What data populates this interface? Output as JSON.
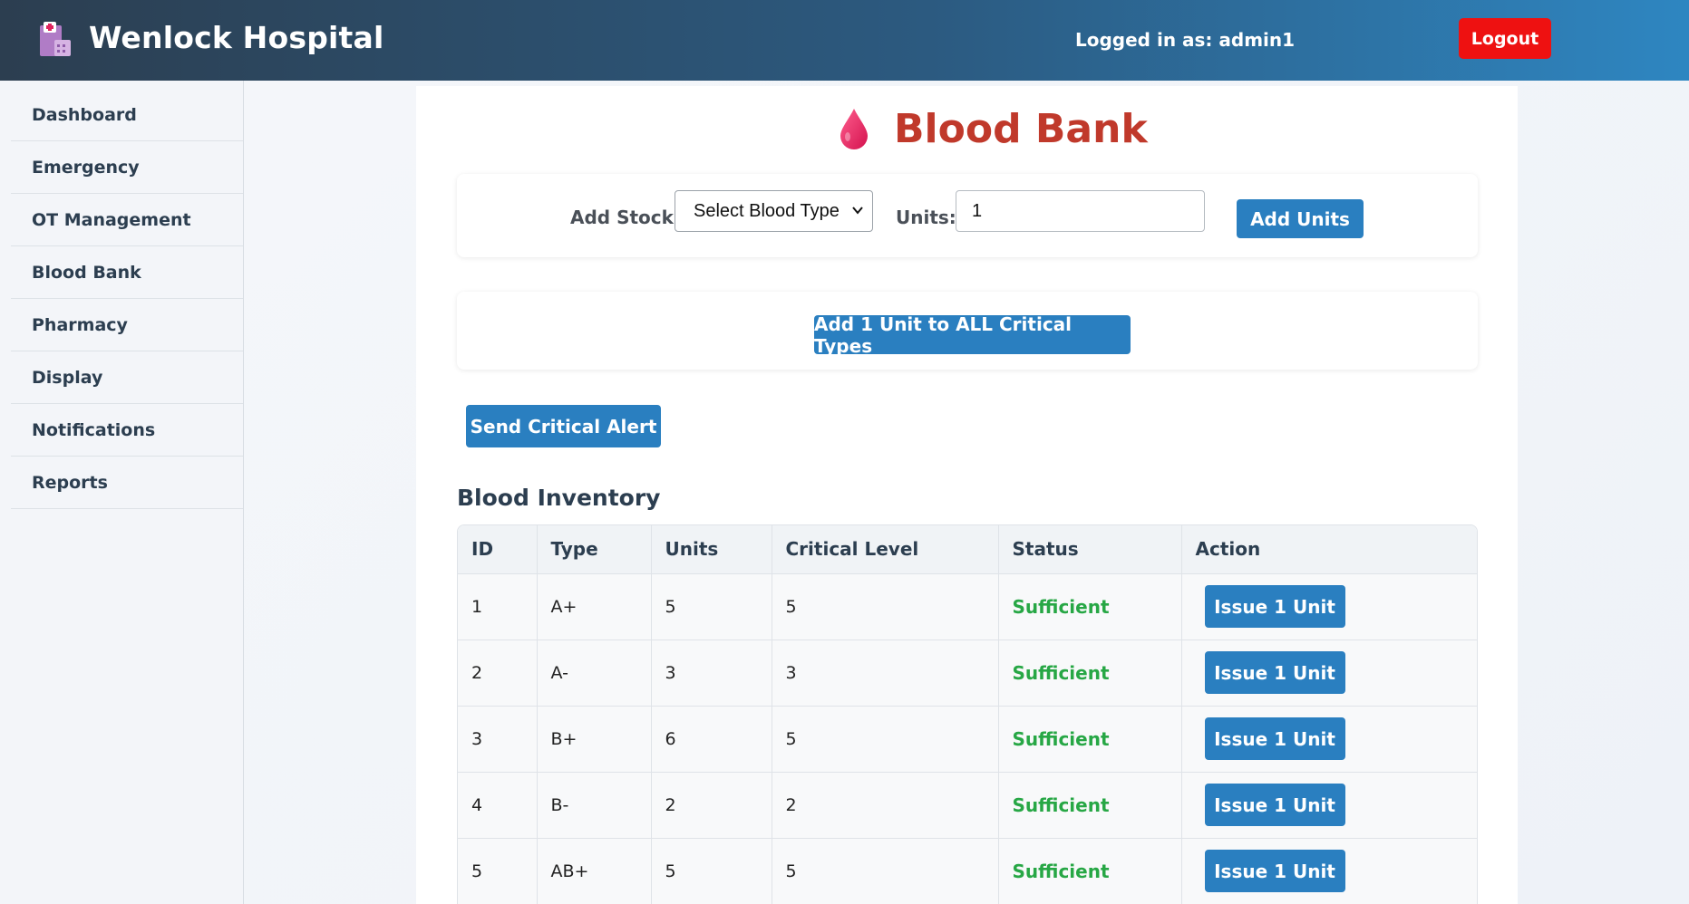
{
  "header": {
    "app_title": "Wenlock Hospital",
    "logged_in_text": "Logged in as: admin1",
    "logout_label": "Logout",
    "logo_icon": "hospital-building-icon"
  },
  "sidebar": {
    "items": [
      {
        "label": "Dashboard"
      },
      {
        "label": "Emergency"
      },
      {
        "label": "OT Management"
      },
      {
        "label": "Blood Bank"
      },
      {
        "label": "Pharmacy"
      },
      {
        "label": "Display"
      },
      {
        "label": "Notifications"
      },
      {
        "label": "Reports"
      }
    ]
  },
  "main": {
    "page_title": "Blood Bank",
    "title_icon": "blood-drop-icon",
    "add_stock": {
      "label": "Add Stock:",
      "select_value": "Select Blood Type",
      "units_label": "Units:",
      "units_value": "1",
      "add_button": "Add Units"
    },
    "add_all_button": "Add 1 Unit to ALL Critical Types",
    "alert_button": "Send Critical Alert",
    "inventory_title": "Blood Inventory",
    "table": {
      "columns": [
        "ID",
        "Type",
        "Units",
        "Critical Level",
        "Status",
        "Action"
      ],
      "rows": [
        {
          "id": "1",
          "type": "A+",
          "units": "5",
          "critical": "5",
          "status": "Sufficient",
          "action": "Issue 1 Unit"
        },
        {
          "id": "2",
          "type": "A-",
          "units": "3",
          "critical": "3",
          "status": "Sufficient",
          "action": "Issue 1 Unit"
        },
        {
          "id": "3",
          "type": "B+",
          "units": "6",
          "critical": "5",
          "status": "Sufficient",
          "action": "Issue 1 Unit"
        },
        {
          "id": "4",
          "type": "B-",
          "units": "2",
          "critical": "2",
          "status": "Sufficient",
          "action": "Issue 1 Unit"
        },
        {
          "id": "5",
          "type": "AB+",
          "units": "5",
          "critical": "5",
          "status": "Sufficient",
          "action": "Issue 1 Unit"
        }
      ]
    }
  },
  "colors": {
    "header_start": "#2c3e50",
    "header_end": "#2e86c1",
    "accent_button": "#2a7fc0",
    "logout": "#ee1111",
    "title_red": "#c0392b",
    "status_sufficient": "#27a745"
  }
}
